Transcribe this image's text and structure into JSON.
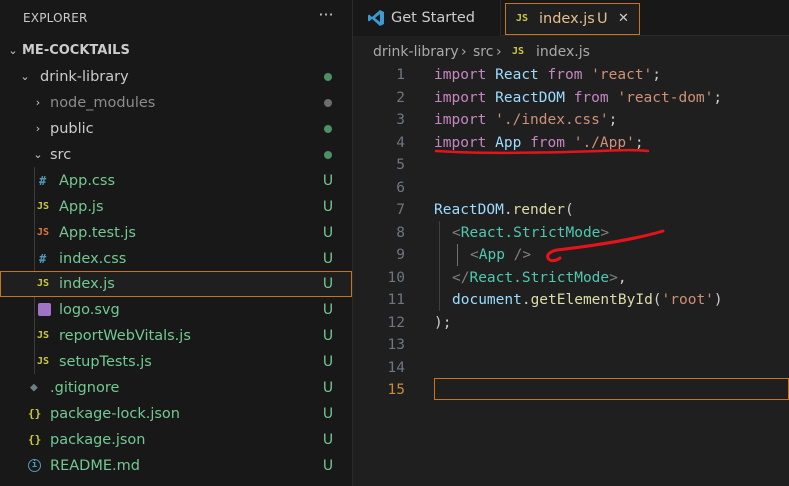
{
  "explorer": {
    "title": "EXPLORER",
    "more_actions": "···",
    "items": [
      {
        "label": "ME-COCKTAILS",
        "icon": "",
        "status": ""
      },
      {
        "label": "drink-library",
        "icon": "",
        "status": ""
      },
      {
        "label": "node_modules",
        "icon": "",
        "status": ""
      },
      {
        "label": "public",
        "icon": "",
        "status": ""
      },
      {
        "label": "src",
        "icon": "",
        "status": ""
      },
      {
        "label": "App.css",
        "icon": "#",
        "status": "U"
      },
      {
        "label": "App.js",
        "icon": "JS",
        "status": "U"
      },
      {
        "label": "App.test.js",
        "icon": "JS",
        "status": "U"
      },
      {
        "label": "index.css",
        "icon": "#",
        "status": "U"
      },
      {
        "label": "index.js",
        "icon": "JS",
        "status": "U"
      },
      {
        "label": "logo.svg",
        "icon": "",
        "status": "U"
      },
      {
        "label": "reportWebVitals.js",
        "icon": "JS",
        "status": "U"
      },
      {
        "label": "setupTests.js",
        "icon": "JS",
        "status": "U"
      },
      {
        "label": ".gitignore",
        "icon": "",
        "status": "U"
      },
      {
        "label": "package-lock.json",
        "icon": "{}",
        "status": "U"
      },
      {
        "label": "package.json",
        "icon": "{}",
        "status": "U"
      },
      {
        "label": "README.md",
        "icon": "",
        "status": "U"
      }
    ]
  },
  "tabs": [
    {
      "label": "Get Started"
    },
    {
      "label": "index.js",
      "icon": "JS",
      "status": "U",
      "close": "✕"
    }
  ],
  "breadcrumb": [
    "drink-library",
    "src",
    "JS",
    "index.js"
  ],
  "code": {
    "line_numbers": [
      "1",
      "2",
      "3",
      "4",
      "5",
      "6",
      "7",
      "8",
      "9",
      "10",
      "11",
      "12",
      "13",
      "14",
      "15"
    ],
    "l1": [
      "import",
      "React",
      "from",
      "'react'",
      ";"
    ],
    "l2": [
      "import",
      "ReactDOM",
      "from",
      "'react-dom'",
      ";"
    ],
    "l3": [
      "import",
      "'./index.css'",
      ";"
    ],
    "l4": [
      "import",
      "App",
      "from",
      "'./App'",
      ";"
    ],
    "l7": [
      "ReactDOM",
      ".",
      "render",
      "("
    ],
    "l8": [
      "<",
      "React.StrictMode",
      ">"
    ],
    "l9": [
      "<",
      "App",
      "/>"
    ],
    "l10": [
      "</",
      "React.StrictMode",
      ">",
      ","
    ],
    "l11": [
      "document",
      ".",
      "getElementById",
      "(",
      "'root'",
      ")"
    ],
    "l12": [
      ");"
    ]
  },
  "colors": {
    "modified_accent": "#c6761a",
    "untracked_green": "#73c991",
    "annotation_red": "#e5141b"
  }
}
